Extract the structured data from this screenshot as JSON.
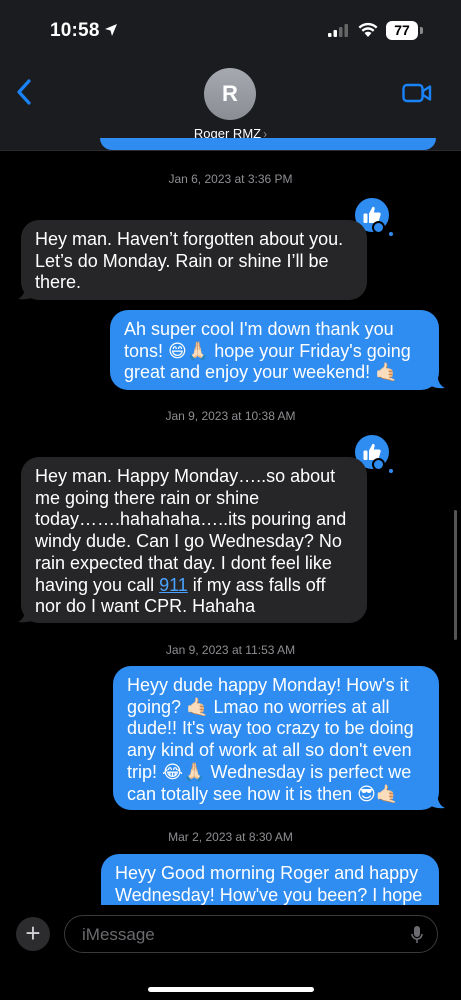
{
  "status_bar": {
    "time": "10:58",
    "battery": "77"
  },
  "header": {
    "avatar_initial": "R",
    "contact_name": "Roger RMZ",
    "contact_chevron": "›"
  },
  "messages": {
    "ts1": "Jan 6, 2023 at 3:36 PM",
    "m1": [
      "Hey man. Haven’t forgotten about you.",
      "Let’s do Monday. Rain or shine I’ll be",
      "there."
    ],
    "m2": [
      "Ah super cool I'm down thank you",
      "tons! 😄🙏🏻 hope your Friday's going",
      "great and enjoy your weekend! 🤙🏻"
    ],
    "ts2": "Jan 9, 2023 at 10:38 AM",
    "m3": {
      "lines": [
        "Hey man.  Happy Monday…..so about",
        "me going there rain or shine",
        "today…….hahahaha…..its pouring and",
        "windy dude.  Can I go Wednesday?  No",
        "rain expected that day.  I dont feel like"
      ],
      "line6_before": "having you call ",
      "line6_link": "911",
      "line6_after": " if my ass falls off",
      "line7": "nor do I want CPR. Hahaha"
    },
    "ts3": "Jan 9, 2023 at 11:53 AM",
    "m4": [
      "Heyy dude happy Monday! How's it",
      "going? 🤙🏻 Lmao no worries at all",
      "dude!! It's way too crazy to be doing",
      "any kind of work at all so don't even",
      "trip! 😂🙏🏻 Wednesday is perfect we",
      "can totally see how it is then 😎🤙🏻"
    ],
    "ts4": "Mar 2, 2023 at 8:30 AM",
    "m5": [
      "Heyy Good morning Roger and happy",
      "Wednesday! How've you been? I hope"
    ]
  },
  "input": {
    "placeholder": "iMessage",
    "plus": "+"
  },
  "icons": {
    "back": "chevron-left-icon",
    "video": "video-camera-icon",
    "thumbs": "thumbs-up-icon",
    "mic": "microphone-icon"
  },
  "colors": {
    "sent_bubble": "#2f8cf0",
    "received_bubble": "#262628",
    "accent": "#1a82f7"
  }
}
